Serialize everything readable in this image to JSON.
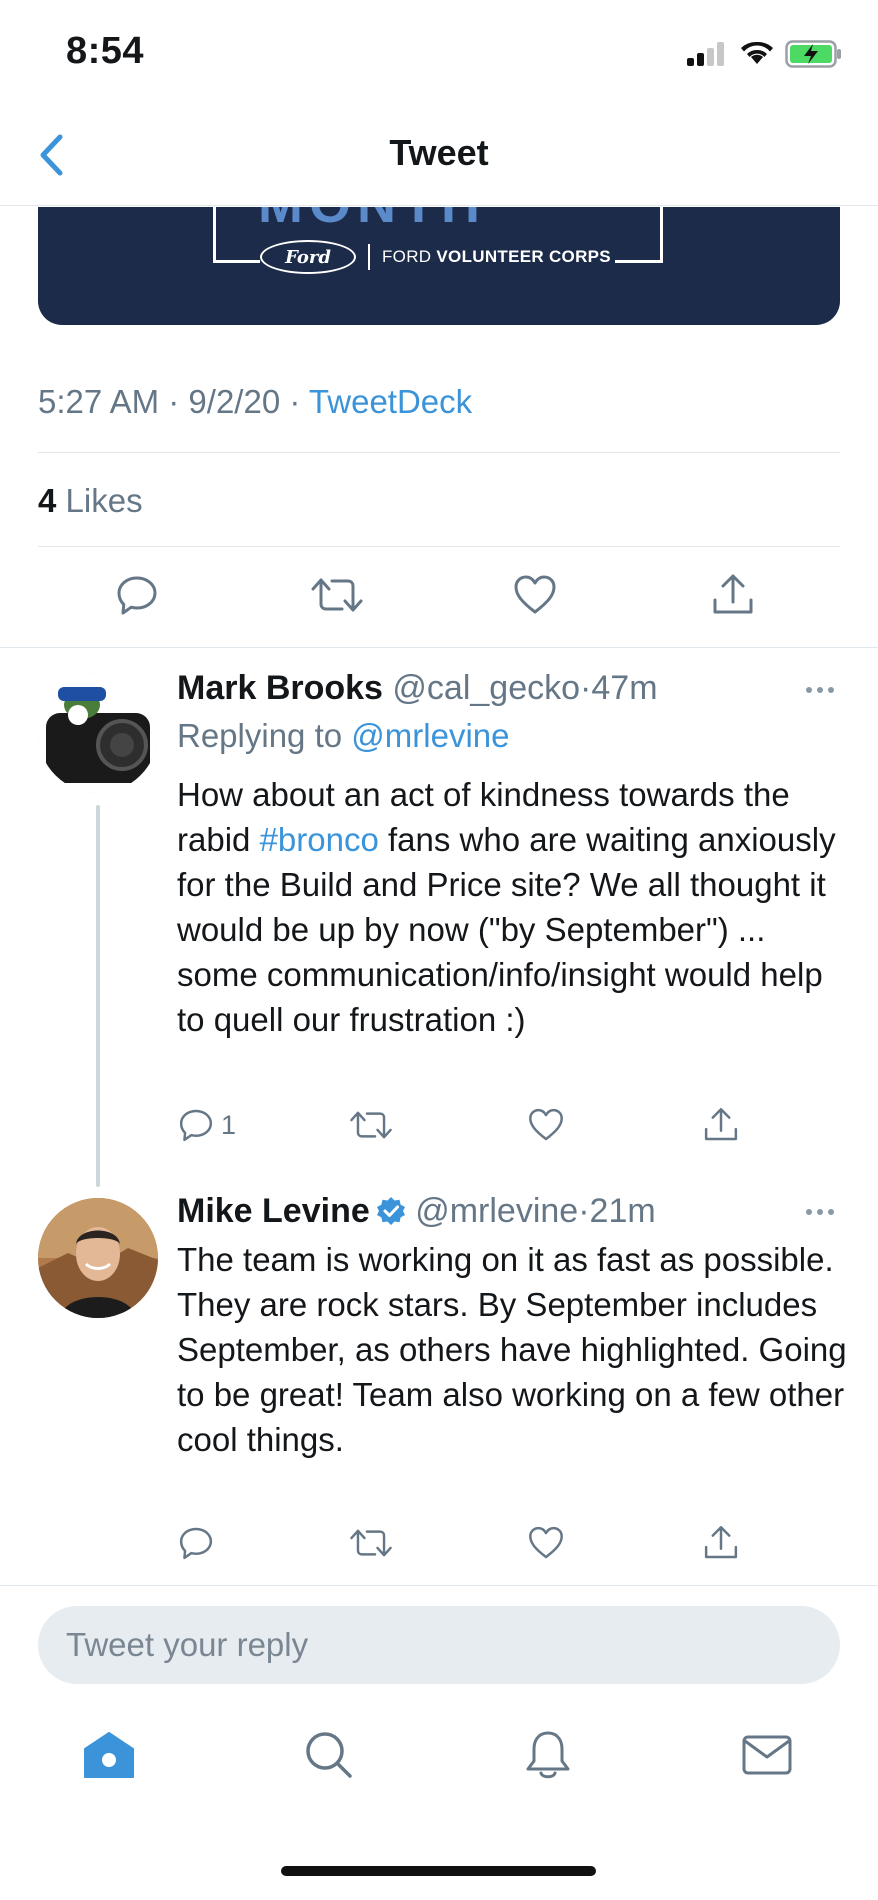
{
  "status_bar": {
    "time": "8:54"
  },
  "nav": {
    "title": "Tweet",
    "back_icon": "chevron-left-icon"
  },
  "banner": {
    "partial_text": "MONTH",
    "ford_logo_text": "Ford",
    "corps_prefix": "FORD",
    "corps_name": "VOLUNTEER CORPS"
  },
  "tweet": {
    "time": "5:27 AM",
    "date": "9/2/20",
    "source": "TweetDeck",
    "separator": "·",
    "likes_count": "4",
    "likes_label": "Likes"
  },
  "replies": [
    {
      "name": "Mark Brooks",
      "handle": "@cal_gecko",
      "age": "47m",
      "replying_label": "Replying to",
      "replying_to": "@mrlevine",
      "text_before_tag": "How about an act of kindness towards the rabid ",
      "hashtag": "#bronco",
      "text_after_tag": " fans who are waiting anxiously for the Build and Price site? We all thought it would be up by now (\"by September\") ... some communication/info/insight would help to quell our frustration :)",
      "reply_count": "1",
      "verified": false
    },
    {
      "name": "Mike Levine",
      "handle": "@mrlevine",
      "age": "21m",
      "text": "The team is working on it as fast as possible. They are rock stars. By September includes September, as others have highlighted. Going to be great! Team also working on a few other cool things.",
      "reply_count": "",
      "verified": true
    }
  ],
  "compose": {
    "placeholder": "Tweet your reply"
  },
  "tabbar": [
    "home-icon",
    "search-icon",
    "notifications-icon",
    "messages-icon"
  ],
  "colors": {
    "accent": "#3b94d9",
    "text": "#14171a",
    "secondary": "#657786",
    "divider": "#e1e8ed"
  }
}
